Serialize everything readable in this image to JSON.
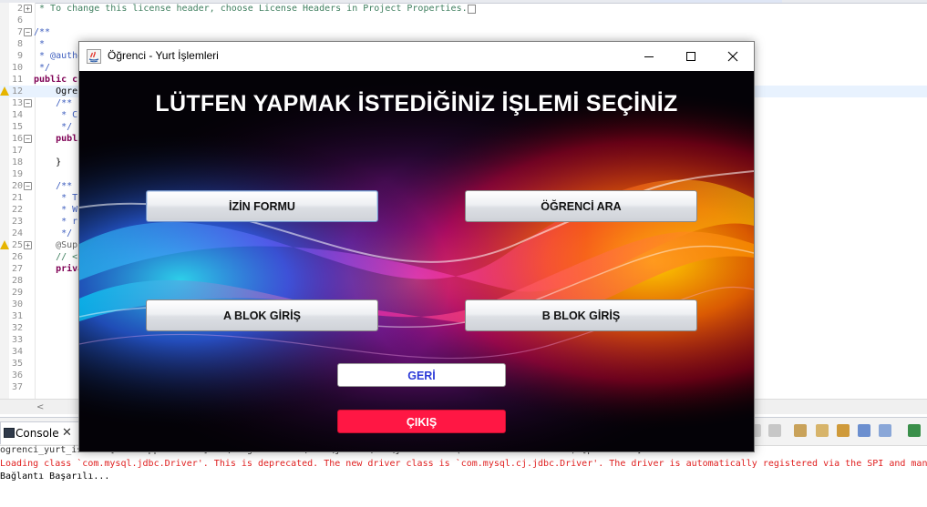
{
  "editor": {
    "lines": [
      {
        "num": "2",
        "fold": "plus",
        "text": " * To change this license header, choose License Headers in Project Properties.",
        "cls": "c-comment"
      },
      {
        "num": "6",
        "text": ""
      },
      {
        "num": "7",
        "fold": "minus",
        "text": "/**",
        "cls": "c-javadoc"
      },
      {
        "num": "8",
        "text": " *",
        "cls": "c-javadoc"
      },
      {
        "num": "9",
        "text": " * @author",
        "cls": "c-javadoc"
      },
      {
        "num": "10",
        "text": " */",
        "cls": "c-javadoc"
      },
      {
        "num": "11",
        "text": "public c",
        "cls": "c-kw"
      },
      {
        "num": "12",
        "text": "    Ogre",
        "cls": "c-plain",
        "warn": true,
        "hl": true
      },
      {
        "num": "13",
        "fold": "minus",
        "text": "    /**",
        "cls": "c-javadoc"
      },
      {
        "num": "14",
        "text": "     * C",
        "cls": "c-javadoc"
      },
      {
        "num": "15",
        "text": "     */",
        "cls": "c-javadoc"
      },
      {
        "num": "16",
        "fold": "minus",
        "text": "    publi",
        "cls": "c-kw"
      },
      {
        "num": "17",
        "text": ""
      },
      {
        "num": "18",
        "text": "    }",
        "cls": "c-plain"
      },
      {
        "num": "19",
        "text": ""
      },
      {
        "num": "20",
        "fold": "minus",
        "text": "    /**",
        "cls": "c-javadoc"
      },
      {
        "num": "21",
        "text": "     * T",
        "cls": "c-javadoc"
      },
      {
        "num": "22",
        "text": "     * W",
        "cls": "c-javadoc"
      },
      {
        "num": "23",
        "text": "     * r",
        "cls": "c-javadoc"
      },
      {
        "num": "24",
        "text": "     */",
        "cls": "c-javadoc"
      },
      {
        "num": "25",
        "fold": "plus",
        "text": "    @Supp",
        "cls": "c-ann",
        "warn": true
      },
      {
        "num": "26",
        "text": "    // <",
        "cls": "c-comment"
      },
      {
        "num": "27",
        "text": "    priva",
        "cls": "c-kw"
      },
      {
        "num": "28",
        "text": ""
      },
      {
        "num": "29",
        "text": ""
      },
      {
        "num": "30",
        "text": ""
      },
      {
        "num": "31",
        "text": ""
      },
      {
        "num": "32",
        "text": ""
      },
      {
        "num": "33",
        "text": ""
      },
      {
        "num": "34",
        "text": ""
      },
      {
        "num": "35",
        "text": ""
      },
      {
        "num": "36",
        "text": ""
      },
      {
        "num": "37",
        "text": ""
      }
    ]
  },
  "console": {
    "tab_label": "Console",
    "close_glyph": "✕",
    "info": "ogrenci_yurt_islemi [Java Application] C:\\Program Files\\Java\\jdk-20\\bin\\javaw.exe  (20 Oca 2024 00:48:09) [pid: 9776]",
    "line1": "Loading class `com.mysql.jdbc.Driver'. This is deprecated. The new driver class is `com.mysql.cj.jdbc.Driver'. The driver is automatically registered via the SPI and manu",
    "line2": "Bağlantı Başarılı..."
  },
  "window": {
    "title": "Öğrenci - Yurt İşlemleri",
    "heading": "LÜTFEN YAPMAK İSTEDİĞİNİZ İŞLEMİ SEÇİNİZ",
    "buttons": {
      "izin": "İZİN FORMU",
      "ogrenci_ara": "ÖĞRENCİ ARA",
      "a_blok": "A BLOK GİRİŞ",
      "b_blok": "B BLOK GİRİŞ",
      "geri": "GERİ",
      "cikis": "ÇIKIŞ"
    }
  }
}
